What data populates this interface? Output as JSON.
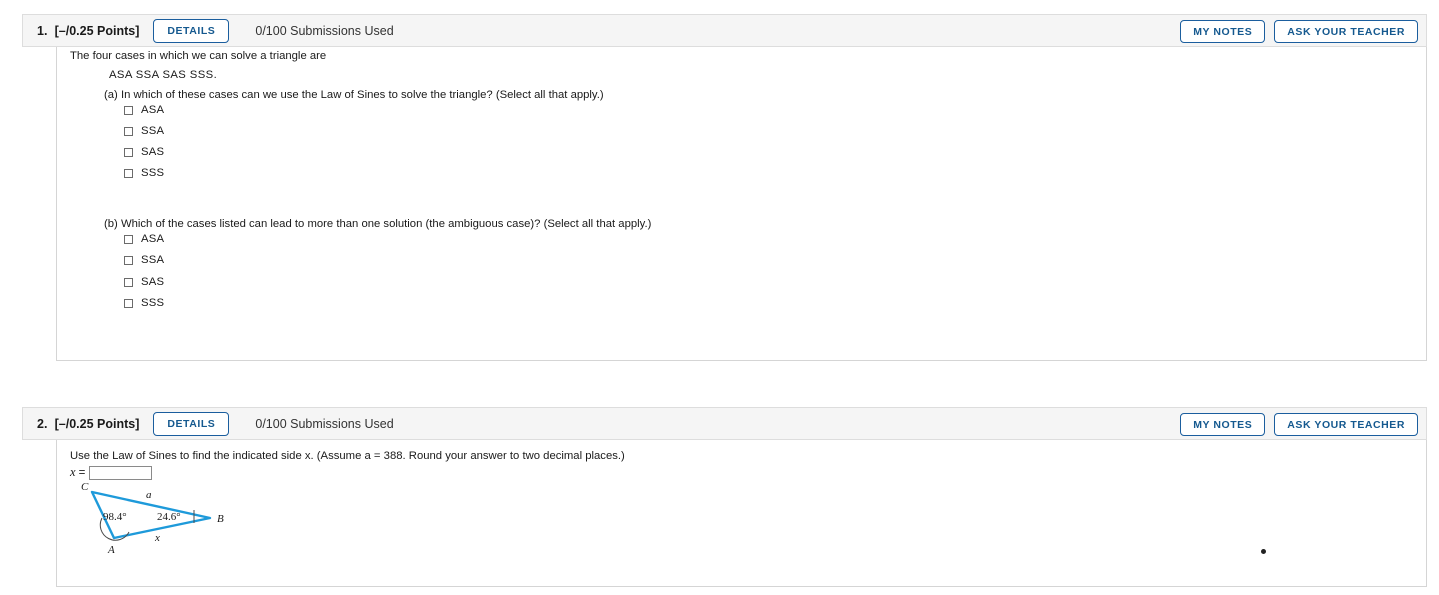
{
  "questions": [
    {
      "number": "1.",
      "points": "[–/0.25 Points]",
      "details_label": "DETAILS",
      "submissions": "0/100 Submissions Used",
      "my_notes_label": "MY NOTES",
      "ask_teacher_label": "ASK YOUR TEACHER",
      "stem": "The four cases in which we can solve a triangle are",
      "cases_line": "ASA  SSA  SAS  SSS.",
      "parts": [
        {
          "label": "(a) In which of these cases can we use the Law of Sines to solve the triangle? (Select all that apply.)",
          "choices": [
            "ASA",
            "SSA",
            "SAS",
            "SSS"
          ]
        },
        {
          "label": "(b) Which of the cases listed can lead to more than one solution (the ambiguous case)? (Select all that apply.)",
          "choices": [
            "ASA",
            "SSA",
            "SAS",
            "SSS"
          ]
        }
      ]
    },
    {
      "number": "2.",
      "points": "[–/0.25 Points]",
      "details_label": "DETAILS",
      "submissions": "0/100 Submissions Used",
      "my_notes_label": "MY NOTES",
      "ask_teacher_label": "ASK YOUR TEACHER",
      "stem": "Use the Law of Sines to find the indicated side x. (Assume a = 388. Round your answer to two decimal places.)",
      "answer_variable": "x",
      "equals": "=",
      "answer_value": "",
      "answer_placeholder": "",
      "figure": {
        "vertices": [
          "C",
          "B",
          "A"
        ],
        "side_labels": [
          "a",
          "x"
        ],
        "angle_labels": [
          "98.4°",
          "24.6°"
        ],
        "stroke_color": "#1e9ada"
      }
    }
  ],
  "colors": {
    "accent_blue": "#15598f",
    "header_bg": "#f5f5f5",
    "border_gray": "#dddddd",
    "figure_blue": "#1e9ada"
  }
}
